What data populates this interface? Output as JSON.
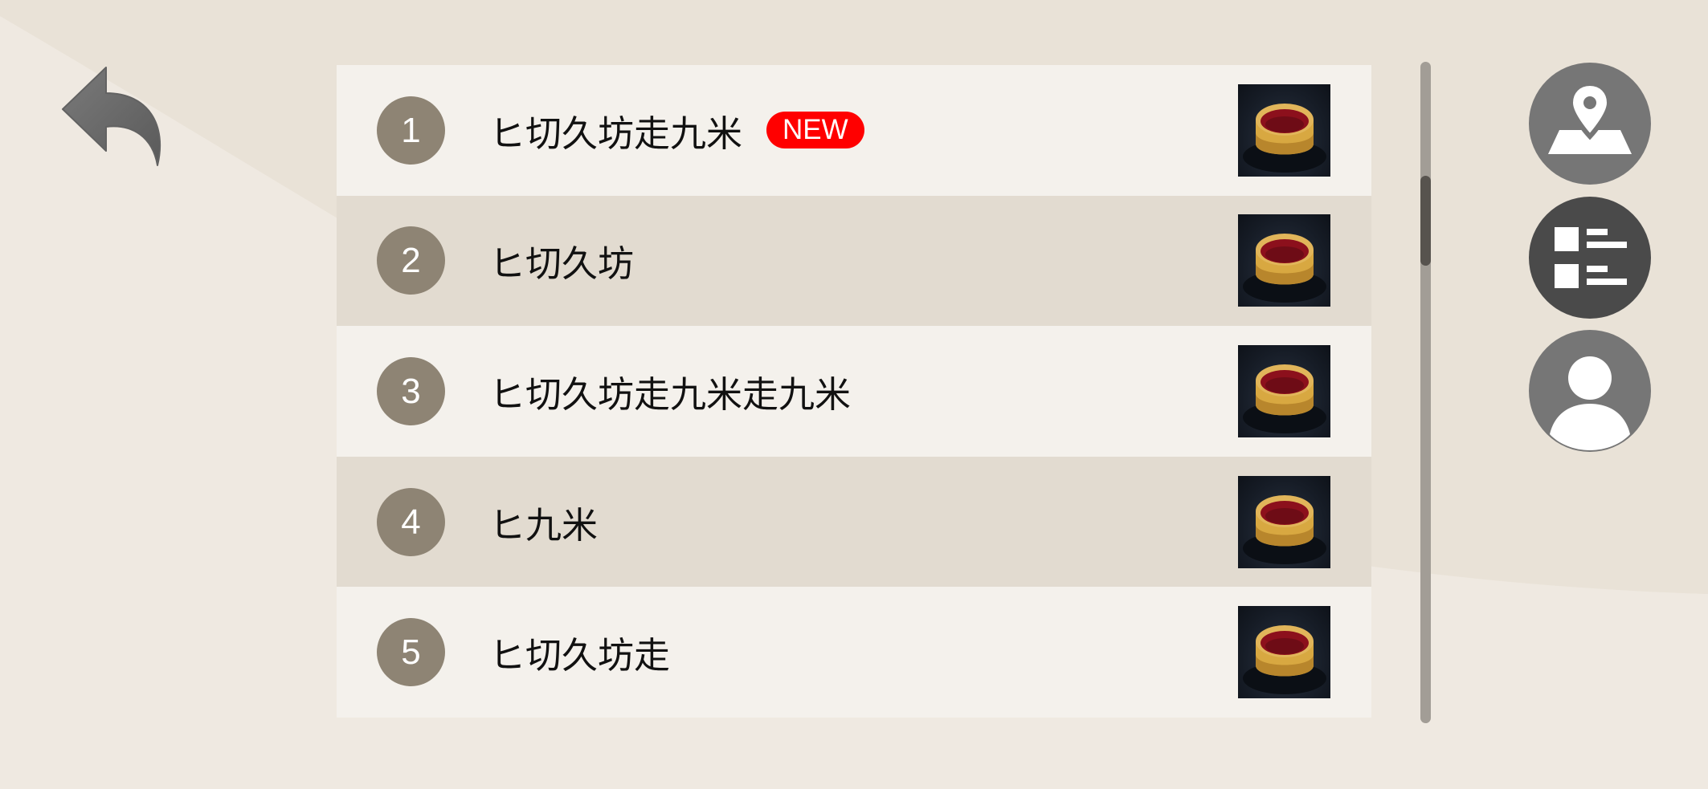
{
  "items": [
    {
      "number": "1",
      "title": "ヒ切久坊走九米",
      "badge": "NEW"
    },
    {
      "number": "2",
      "title": "ヒ切久坊",
      "badge": ""
    },
    {
      "number": "3",
      "title": "ヒ切久坊走九米走九米",
      "badge": ""
    },
    {
      "number": "4",
      "title": "ヒ九米",
      "badge": ""
    },
    {
      "number": "5",
      "title": "ヒ切久坊走",
      "badge": ""
    }
  ],
  "icons": {
    "back": "back-arrow-icon",
    "map": "map-pin-icon",
    "list": "list-view-icon",
    "profile": "user-profile-icon"
  },
  "colors": {
    "background": "#ebe4da",
    "row_light": "#f4f1ec",
    "row_dark": "#e2dbd0",
    "number_badge": "#8e8474",
    "new_badge": "#ff0000",
    "button_gray": "#767676",
    "button_active": "#4a4a4a"
  },
  "scroll": {
    "position_fraction": 0.2
  }
}
